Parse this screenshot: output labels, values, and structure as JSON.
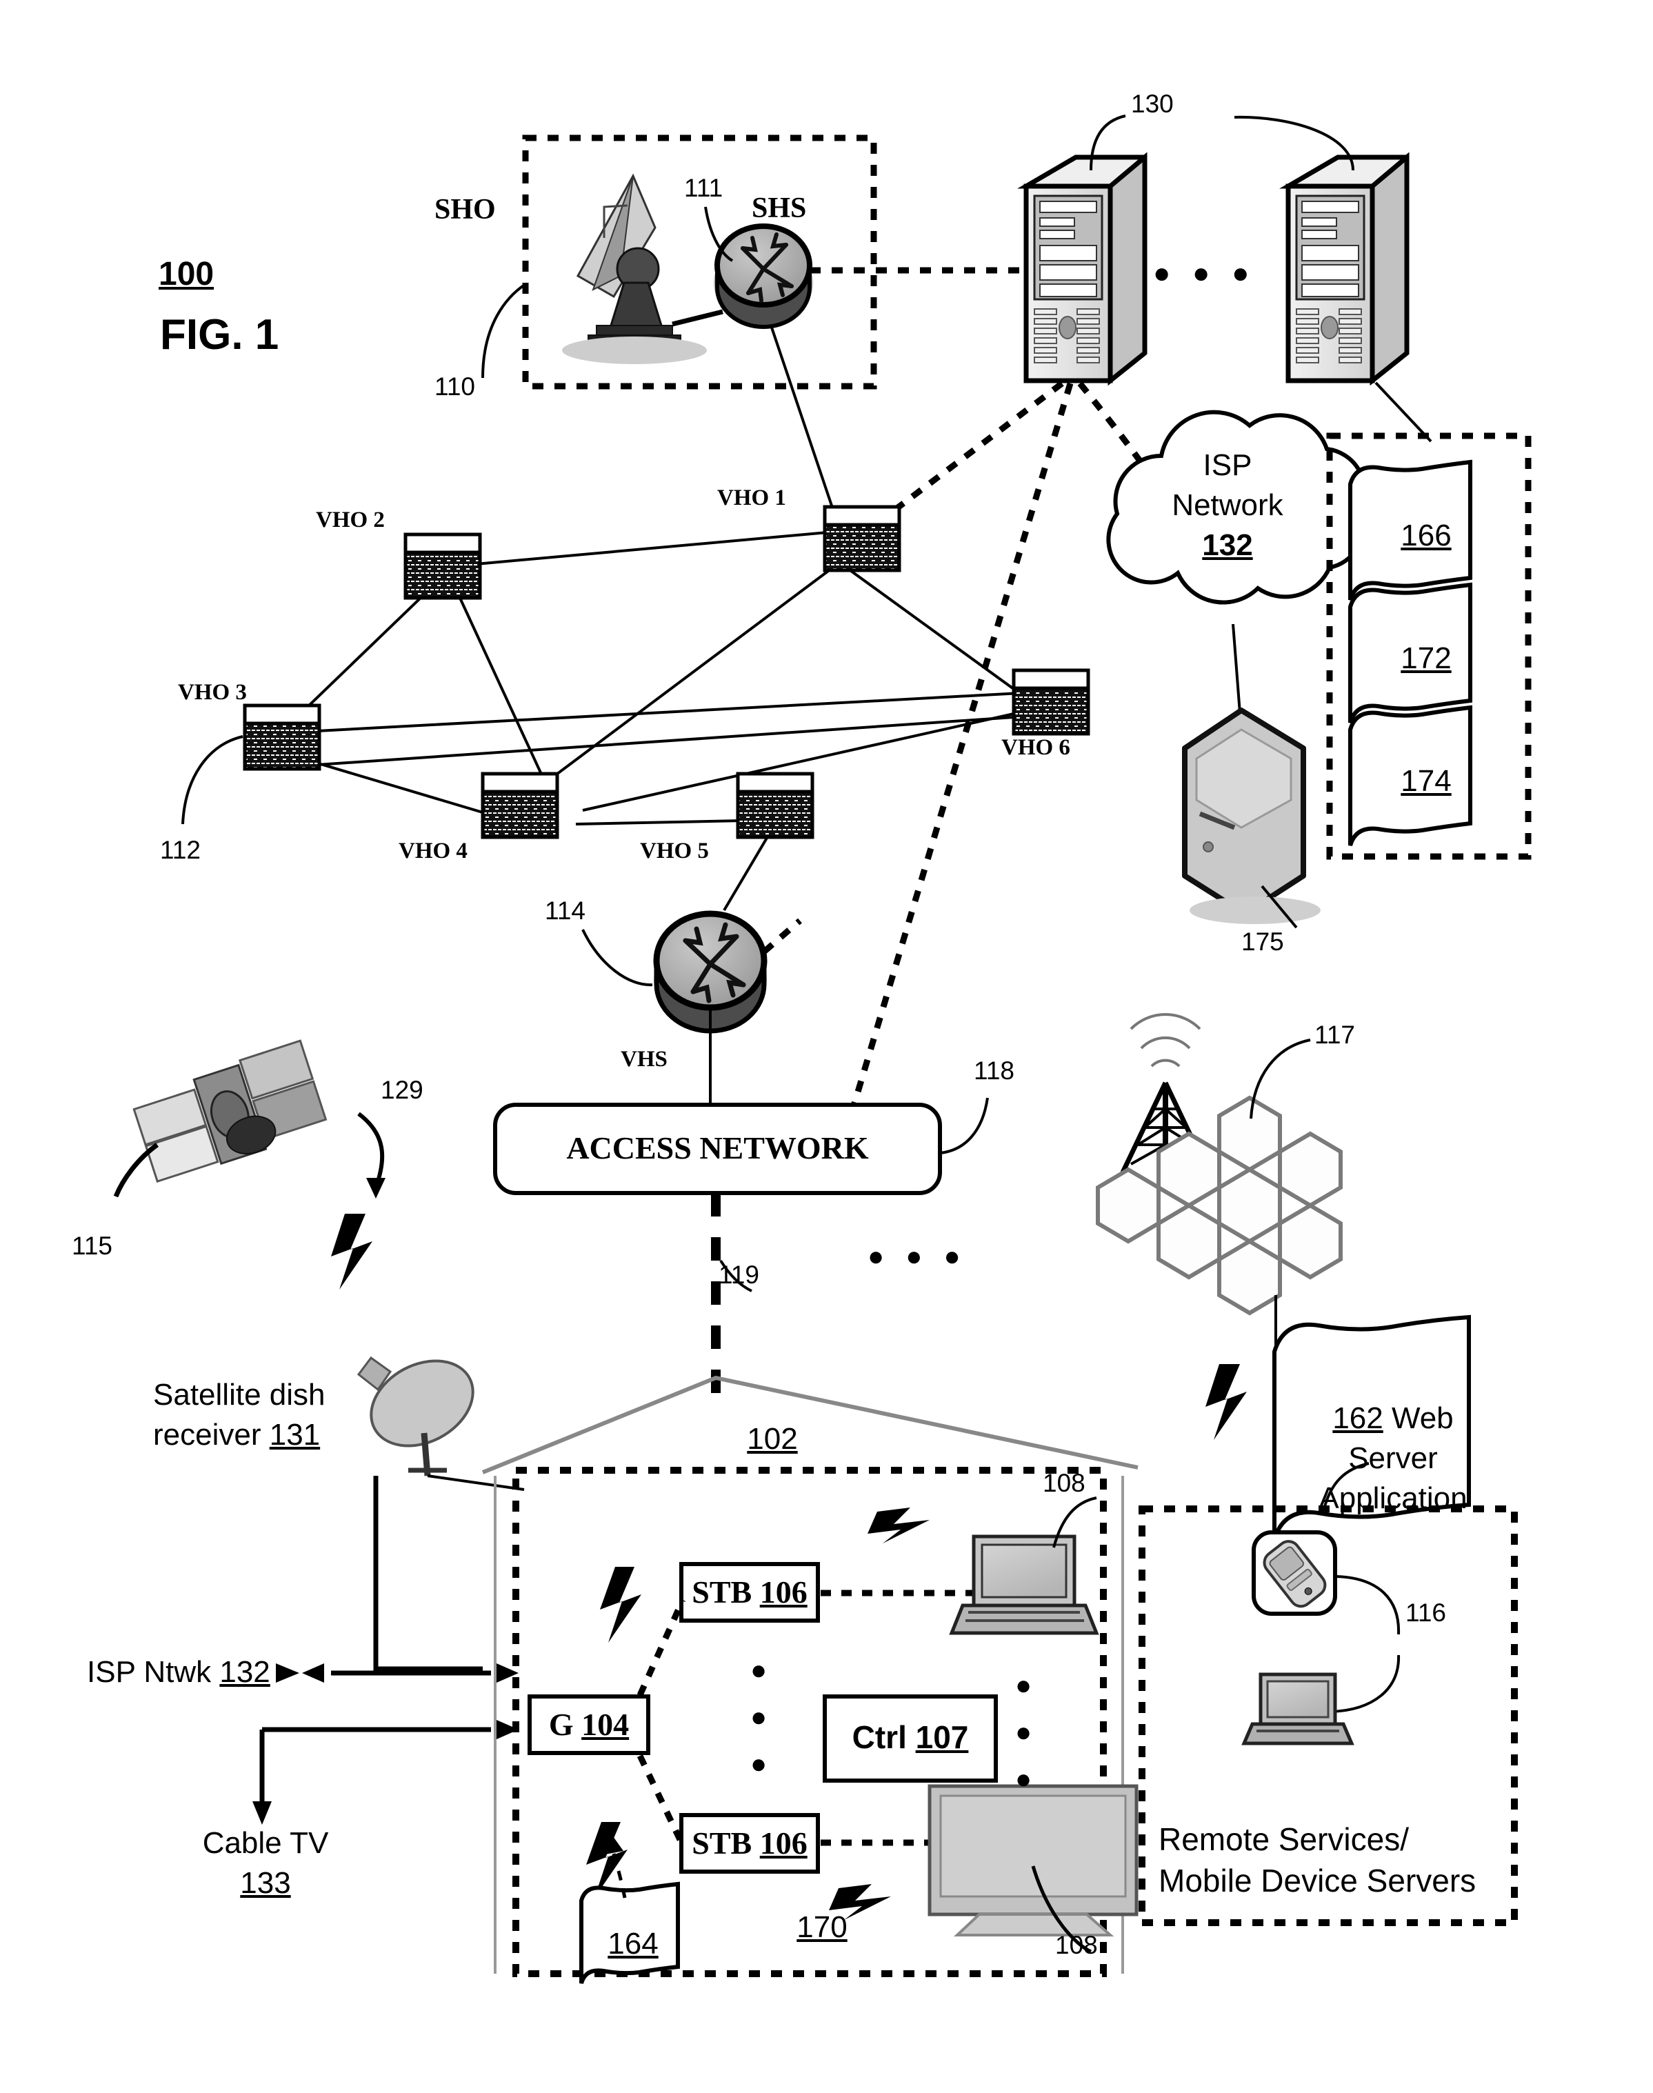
{
  "figure": {
    "number_label": "100",
    "caption": "FIG. 1"
  },
  "sho": {
    "label": "SHO",
    "ref": "110",
    "dish_ref": "111",
    "switch_label": "SHS"
  },
  "servers": {
    "ref": "130",
    "ellipsis": "● ● ●"
  },
  "vho": {
    "nodes": [
      {
        "name": "VHO 1"
      },
      {
        "name": "VHO 2"
      },
      {
        "name": "VHO 3"
      },
      {
        "name": "VHO 4"
      },
      {
        "name": "VHO 5"
      },
      {
        "name": "VHO 6"
      }
    ],
    "ref": "112"
  },
  "vhs": {
    "label": "VHS",
    "ref": "114"
  },
  "isp_cloud": {
    "line1": "ISP",
    "line2": "Network",
    "ref": "132"
  },
  "isp_server": {
    "ref": "175"
  },
  "documents_panel": {
    "items": [
      "166",
      "172",
      "174"
    ]
  },
  "access_network": {
    "label": "ACCESS NETWORK",
    "ref": "118",
    "link_ref": "119",
    "ellipsis": "● ● ●"
  },
  "satellite": {
    "ref": "115",
    "downlink_ref": "129",
    "dish_receiver_line1": "Satellite dish",
    "dish_receiver_line2_text": "receiver ",
    "dish_receiver_ref": "131"
  },
  "left_links": {
    "isp_ntwk_text": "ISP Ntwk ",
    "isp_ntwk_ref": "132",
    "cable_tv_line1": "Cable TV",
    "cable_tv_ref": "133"
  },
  "cell": {
    "ref": "117"
  },
  "web_server_doc": {
    "ref": "162",
    "line1_text": " Web",
    "line2": "Server",
    "line3": "Application"
  },
  "home": {
    "ref": "102",
    "gateway_text": "G ",
    "gateway_ref": "104",
    "stb_text": "STB ",
    "stb_ref": "106",
    "ctrl_text": "Ctrl ",
    "ctrl_ref": "107",
    "media_ref": "108",
    "doc_ref": "164",
    "network_ref": "170",
    "vdots": "●"
  },
  "remote_services": {
    "ref": "116",
    "line1": "Remote Services/",
    "line2": "Mobile Device Servers"
  },
  "colors": {
    "ink": "#000000",
    "node_fill": "#1a1a1a",
    "device_gray": "#b8b8b8",
    "light_gray": "#d8d8d8"
  }
}
